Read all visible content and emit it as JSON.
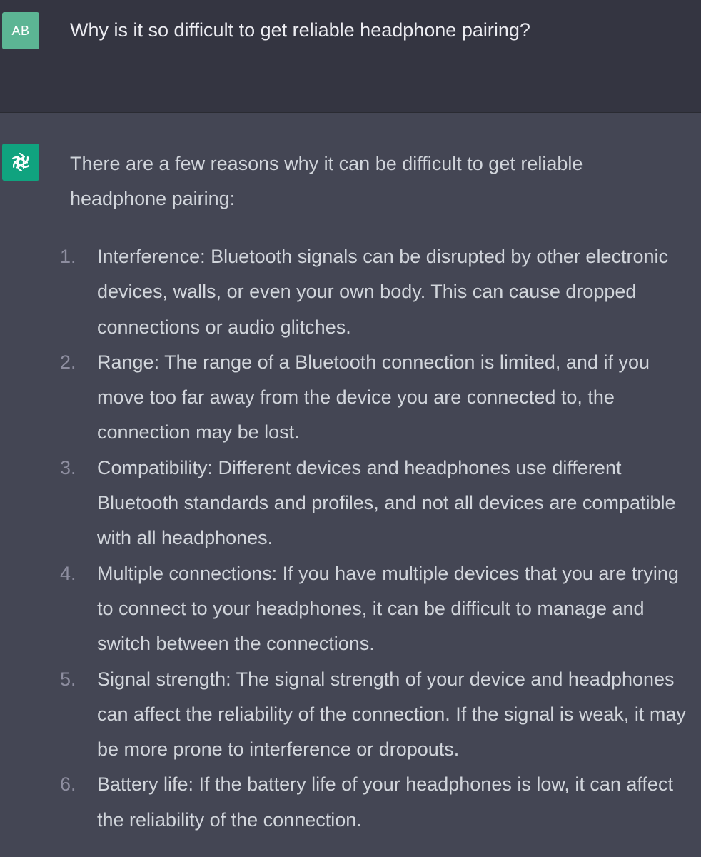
{
  "user_message": {
    "avatar_initials": "AB",
    "text": "Why is it so difficult to get reliable headphone pairing?"
  },
  "assistant_message": {
    "avatar_icon": "openai-logo-icon",
    "intro": "There are a few reasons why it can be difficult to get reliable headphone pairing:",
    "reasons": [
      {
        "number": "1.",
        "text": "Interference: Bluetooth signals can be disrupted by other electronic devices, walls, or even your own body. This can cause dropped connections or audio glitches."
      },
      {
        "number": "2.",
        "text": "Range: The range of a Bluetooth connection is limited, and if you move too far away from the device you are connected to, the connection may be lost."
      },
      {
        "number": "3.",
        "text": "Compatibility: Different devices and headphones use different Bluetooth standards and profiles, and not all devices are compatible with all headphones."
      },
      {
        "number": "4.",
        "text": "Multiple connections: If you have multiple devices that you are trying to connect to your headphones, it can be difficult to manage and switch between the connections."
      },
      {
        "number": "5.",
        "text": "Signal strength: The signal strength of your device and headphones can affect the reliability of the connection. If the signal is weak, it may be more prone to interference or dropouts."
      },
      {
        "number": "6.",
        "text": "Battery life: If the battery life of your headphones is low, it can affect the reliability of the connection."
      }
    ]
  },
  "colors": {
    "user_row_bg": "#343541",
    "assistant_row_bg": "#444654",
    "user_avatar_bg": "#5cb594",
    "assistant_avatar_bg": "#10a37f",
    "text": "#d1d5db",
    "list_number": "#8e8ea0"
  }
}
